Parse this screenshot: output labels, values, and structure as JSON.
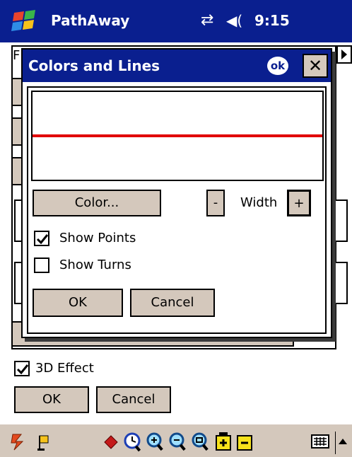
{
  "titlebar": {
    "app_name": "PathAway",
    "time": "9:15",
    "logo_icon": "windows-start-flag-icon",
    "connectivity_icon": "connectivity-arrows-icon",
    "volume_icon": "speaker-volume-icon"
  },
  "background": {
    "frame_glyph": "F",
    "three_d_effect_label": "3D Effect",
    "three_d_effect_checked": true,
    "ok_label": "OK",
    "cancel_label": "Cancel"
  },
  "dialog": {
    "title": "Colors and Lines",
    "ok_badge": "ok",
    "close_label": "✕",
    "line_color": "#e10000",
    "color_button_label": "Color...",
    "width_decrease_label": "-",
    "width_label": "Width",
    "width_increase_label": "+",
    "show_points_label": "Show Points",
    "show_points_checked": true,
    "show_turns_label": "Show Turns",
    "show_turns_checked": false,
    "ok_label": "OK",
    "cancel_label": "Cancel"
  },
  "taskbar": {
    "icons": [
      "lightning-tools-icon",
      "flag-waypoint-icon",
      "diamond-marker-icon",
      "clock-search-icon",
      "zoom-in-icon",
      "zoom-out-icon",
      "zoom-fit-icon",
      "zoom-in-box-icon",
      "zoom-out-box-icon",
      "keyboard-icon",
      "sip-arrow-up-icon"
    ]
  },
  "colors": {
    "title_bar": "#0a1f8f",
    "button_face": "#d4c8bc",
    "accent_line": "#e10000"
  }
}
